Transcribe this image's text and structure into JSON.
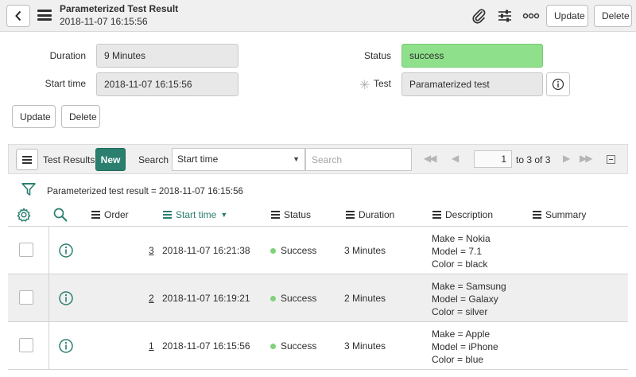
{
  "header": {
    "title": "Parameterized Test Result",
    "subtitle": "2018-11-07 16:15:56",
    "update_label": "Update",
    "delete_label": "Delete"
  },
  "form": {
    "duration_label": "Duration",
    "duration_value": "9 Minutes",
    "start_time_label": "Start time",
    "start_time_value": "2018-11-07 16:15:56",
    "status_label": "Status",
    "status_value": "success",
    "test_label": "Test",
    "test_value": "Paramaterized test",
    "update_label": "Update",
    "delete_label": "Delete"
  },
  "list": {
    "title": "Test Results",
    "new_label": "New",
    "search_label": "Search",
    "search_field": "Start time",
    "search_placeholder": "Search",
    "page_value": "1",
    "page_of": "to 3 of 3",
    "breadcrumb": "Parameterized test result = 2018-11-07 16:15:56",
    "columns": {
      "order": "Order",
      "start_time": "Start time",
      "status": "Status",
      "duration": "Duration",
      "description": "Description",
      "summary": "Summary"
    },
    "rows": [
      {
        "order": "3",
        "start_time": "2018-11-07 16:21:38",
        "status": "Success",
        "duration": "3 Minutes",
        "desc": [
          "Make = Nokia",
          "Model = 7.1",
          "Color = black"
        ]
      },
      {
        "order": "2",
        "start_time": "2018-11-07 16:19:21",
        "status": "Success",
        "duration": "2 Minutes",
        "desc": [
          "Make = Samsung",
          "Model = Galaxy",
          "Color = silver"
        ]
      },
      {
        "order": "1",
        "start_time": "2018-11-07 16:15:56",
        "status": "Success",
        "duration": "3 Minutes",
        "desc": [
          "Make = Apple",
          "Model = iPhone",
          "Color = blue"
        ]
      }
    ]
  },
  "colors": {
    "accent": "#2a7f6f",
    "success_field": "#8ee08a",
    "success_dot": "#80d27a"
  }
}
